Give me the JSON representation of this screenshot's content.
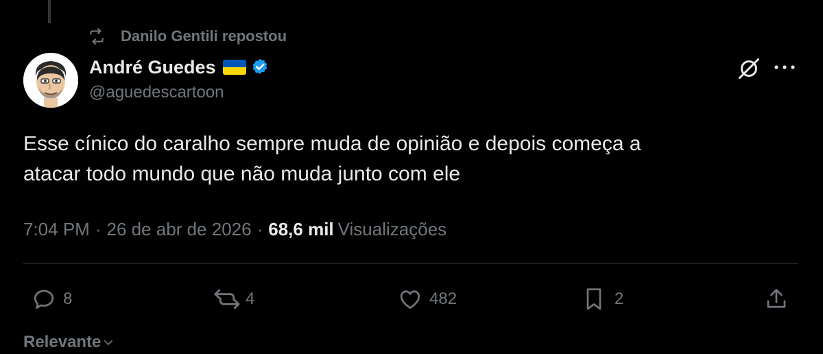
{
  "repost": {
    "text": "Danilo Gentili repostou",
    "icon": "repost-icon"
  },
  "author": {
    "name": "André Guedes",
    "handle": "@aguedescartoon",
    "flag": "ukraine-flag-icon",
    "verified": "verified-badge-icon"
  },
  "tweet": {
    "line1": "Esse cínico do caralho sempre muda de opinião e depois começa a",
    "line2": "atacar todo mundo que não muda junto com ele"
  },
  "meta": {
    "time": "7:04 PM",
    "date": "26 de abr de 2026",
    "separator": "·",
    "views_count": "68,6 mil",
    "views_label": "Visualizações"
  },
  "actions": {
    "replies": "8",
    "reposts": "4",
    "likes": "482",
    "bookmarks": "2"
  },
  "sort": {
    "label": "Relevante"
  },
  "colors": {
    "background": "#000000",
    "text": "#e7e9ea",
    "muted": "#71767b",
    "verified": "#1d9bf0",
    "flag_blue": "#0057b7",
    "flag_yellow": "#ffd700"
  }
}
